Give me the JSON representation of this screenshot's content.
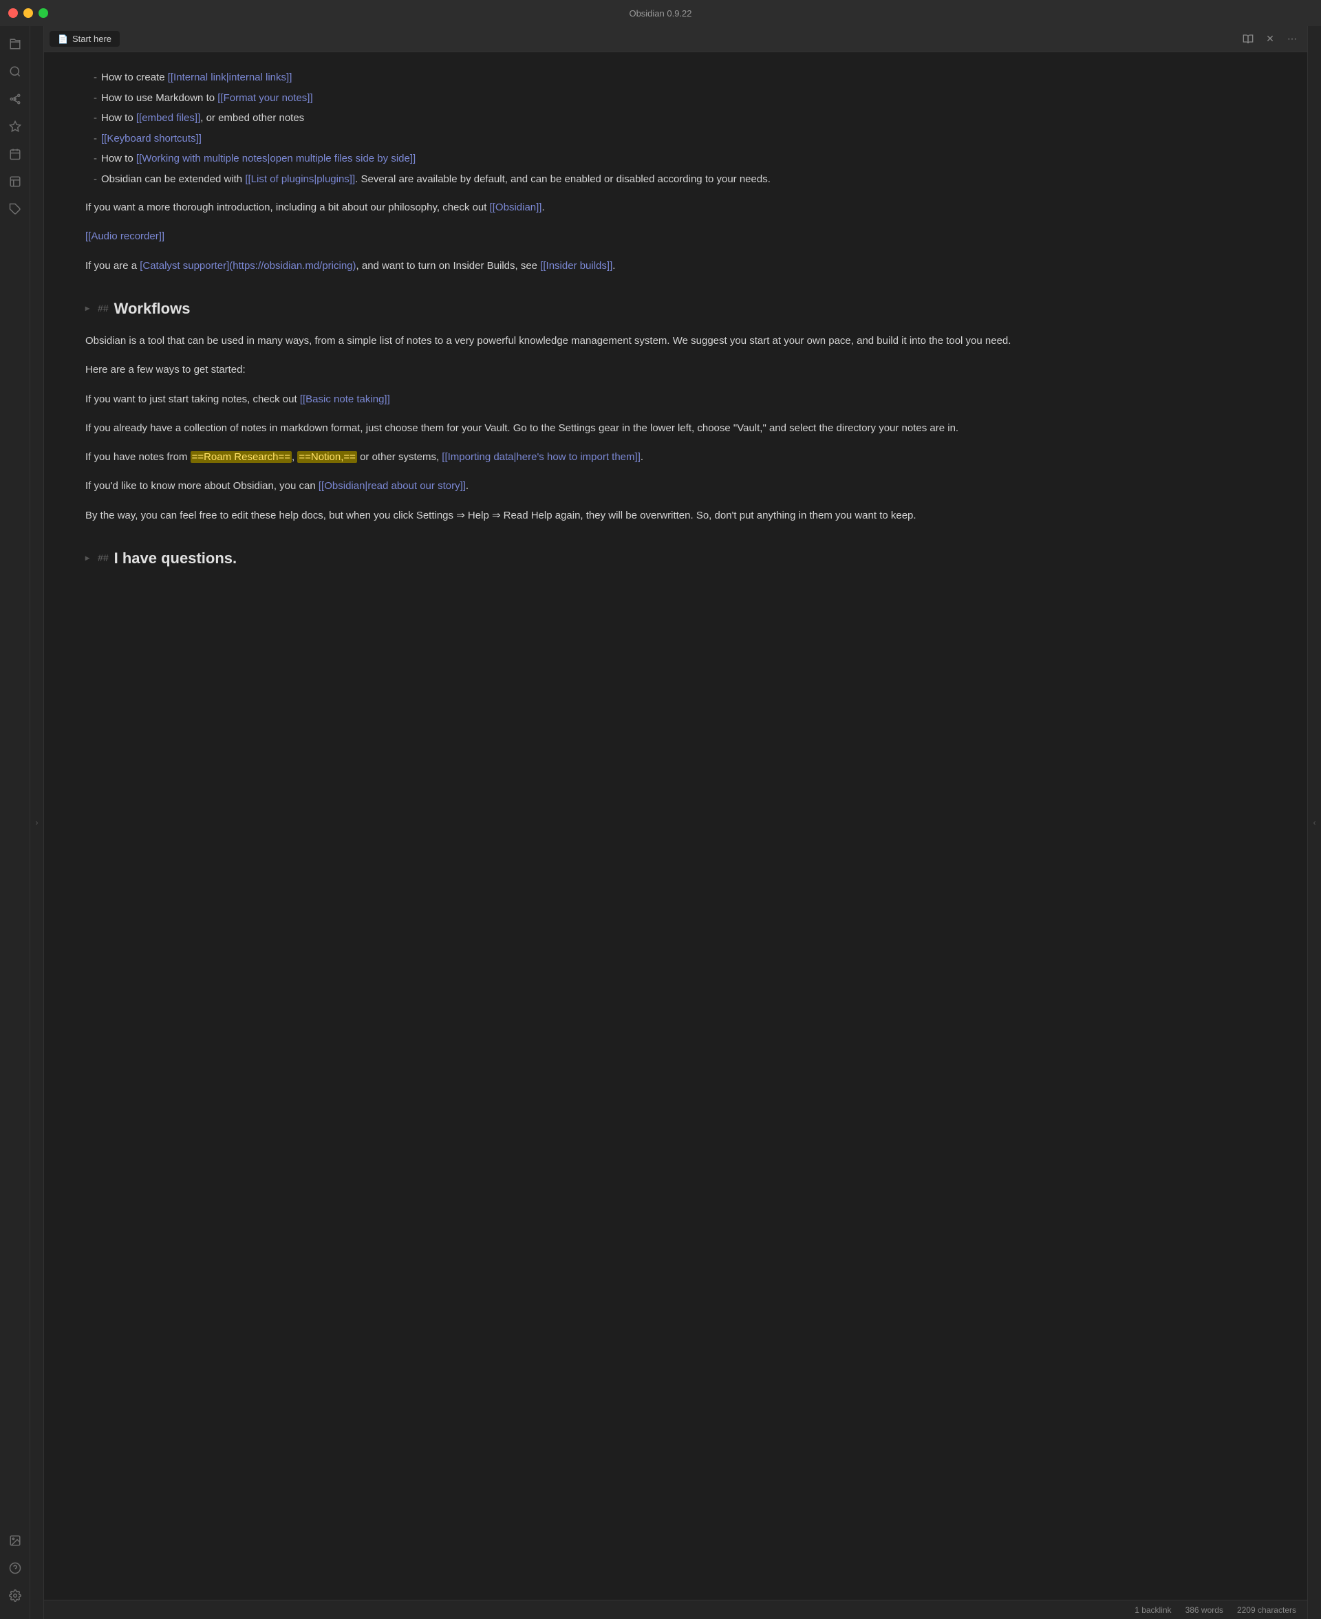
{
  "titlebar": {
    "title": "Obsidian 0.9.22",
    "btn_close": "close",
    "btn_minimize": "minimize",
    "btn_maximize": "maximize"
  },
  "tab": {
    "icon": "📄",
    "title": "Start here",
    "action_reader": "☰",
    "action_close": "✕",
    "action_more": "⋯"
  },
  "sidebar_left": {
    "icons": [
      {
        "name": "toggle-left-icon",
        "symbol": "‹",
        "title": "Toggle left sidebar"
      },
      {
        "name": "files-icon",
        "symbol": "⊞",
        "title": "Files"
      },
      {
        "name": "search-icon",
        "symbol": "⌕",
        "title": "Search"
      },
      {
        "name": "graph-icon",
        "symbol": "⊹",
        "title": "Graph view"
      },
      {
        "name": "starred-icon",
        "symbol": "★",
        "title": "Starred"
      },
      {
        "name": "calendar-icon",
        "symbol": "☰",
        "title": "Calendar"
      },
      {
        "name": "templates-icon",
        "symbol": "⊟",
        "title": "Templates"
      },
      {
        "name": "tags-icon",
        "symbol": "◫",
        "title": "Tags"
      }
    ],
    "bottom_icons": [
      {
        "name": "media-icon",
        "symbol": "▷",
        "title": "Media"
      },
      {
        "name": "help-icon",
        "symbol": "?",
        "title": "Help"
      },
      {
        "name": "settings-icon",
        "symbol": "⚙",
        "title": "Settings"
      }
    ]
  },
  "content": {
    "list_items": [
      {
        "text": "How to create ",
        "link_text": "[[Internal link|internal links]]",
        "link_href": "#internal-links"
      },
      {
        "text": "How to use Markdown to ",
        "link_text": "[[Format your notes]]",
        "link_href": "#format-notes"
      },
      {
        "text": "How to ",
        "link_text": "[[embed files]]",
        "link_href": "#embed-files",
        "suffix": ", or embed other notes"
      },
      {
        "text": "",
        "link_text": "[[Keyboard shortcuts]]",
        "link_href": "#keyboard-shortcuts"
      },
      {
        "text": "How to ",
        "link_text": "[[Working with multiple notes|open multiple files side by side]]",
        "link_href": "#multiple-notes"
      },
      {
        "text": "Obsidian can be extended with ",
        "link_text": "[[List of plugins|plugins]]",
        "link_href": "#plugins",
        "suffix": ". Several are available by default, and can be enabled or disabled according to your needs."
      }
    ],
    "para_intro": "If you want a more thorough introduction, including a bit about our philosophy, check out ",
    "para_intro_link": "[[Obsidian]]",
    "para_intro_suffix": ".",
    "audio_recorder_link": "[[Audio recorder]]",
    "catalyst_para_start": "If you are a ",
    "catalyst_link_text": "[Catalyst supporter](https://obsidian.md/pricing)",
    "catalyst_para_mid": ", and want to turn on Insider Builds, see ",
    "insider_link": "[[Insider builds]]",
    "insider_suffix": ".",
    "section_workflows": {
      "heading": "## Workflows",
      "heading_marker": "##",
      "heading_text": "Workflows",
      "para1": "Obsidian is a tool that can be used in many ways, from a simple list of notes to a very powerful knowledge management system. We suggest you start at your own pace, and build it into the tool you need.",
      "para2": "Here are a few ways to get started:",
      "para3_start": "If you want to just start taking notes, check out ",
      "basic_notes_link": "[[Basic note taking]]",
      "para4": "If you already have a collection of notes in markdown format, just choose them for your Vault. Go to the Settings gear in the lower left, choose \"Vault,\" and select the directory your notes are in.",
      "para5_start": "If you have notes from ",
      "highlight1": "==Roam Research==",
      "para5_mid1": ", ",
      "highlight2": "==Notion,==",
      "para5_mid2": " or other systems, ",
      "importing_link": "[[Importing data|here's how to import them]]",
      "para5_end": ".",
      "para6_start": "If you'd like to know more about Obsidian, you can ",
      "obsidian_story_link": "[[Obsidian|read about our story]]",
      "para6_end": ".",
      "para7": "By the way, you can feel free to edit these help docs, but when you click Settings ⇒ Help ⇒ Read Help again, they will be overwritten. So, don't put anything in them you want to keep."
    },
    "section_questions": {
      "heading": "## I have questions.",
      "heading_marker": "##",
      "heading_text": "I have questions."
    }
  },
  "status_bar": {
    "backlinks": "1 backlink",
    "words": "386 words",
    "characters": "2209 characters"
  }
}
